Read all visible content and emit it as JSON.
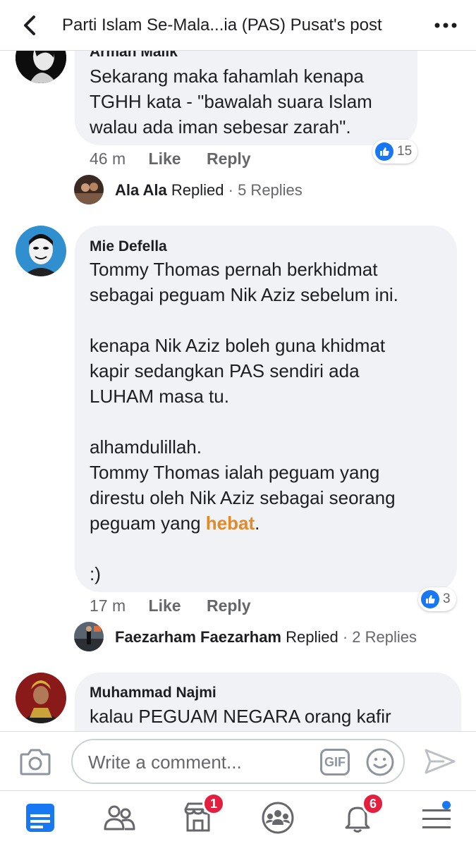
{
  "header": {
    "title": "Parti Islam Se-Mala...ia (PAS) Pusat's post"
  },
  "comments": [
    {
      "author": "Arman Malik",
      "lines": [
        "Sekarang maka fahamlah kenapa",
        "TGHH kata - \"bawalah suara Islam",
        "walau ada iman sebesar zarah\"."
      ],
      "time": "46 m",
      "like_label": "Like",
      "reply_label": "Reply",
      "reactions": "15",
      "replied": {
        "name": "Ala Ala",
        "verb": "Replied",
        "count": "· 5 Replies"
      }
    },
    {
      "author": "Mie Defella",
      "lines": [
        "Tommy Thomas pernah berkhidmat",
        "sebagai peguam  Nik Aziz sebelum ini.",
        "",
        "kenapa Nik Aziz boleh guna khidmat",
        "kapir sedangkan PAS sendiri ada",
        "LUHAM masa tu.",
        "",
        "alhamdulillah.",
        "Tommy Thomas ialah peguam yang",
        "direstu oleh Nik Aziz sebagai seorang",
        "",
        "",
        ":)"
      ],
      "highlight_prefix": "peguam yang ",
      "highlight_word": "hebat",
      "highlight_suffix": ".",
      "time": "17 m",
      "like_label": "Like",
      "reply_label": "Reply",
      "reactions": "3",
      "replied": {
        "name": "Faezarham Faezarham",
        "verb": "Replied",
        "count": "· 2 Replies"
      }
    },
    {
      "author": "Muhammad Najmi",
      "lines": [
        "kalau PEGUAM NEGARA orang kafir"
      ]
    }
  ],
  "composer": {
    "placeholder": "Write a comment...",
    "gif_label": "GIF"
  },
  "tabs": {
    "marketplace_badge": "1",
    "notifications_badge": "6"
  },
  "colors": {
    "accent": "#1877f2",
    "highlight": "#e4892a",
    "badge": "#e41e3f",
    "bubble": "#f0f2f5"
  }
}
